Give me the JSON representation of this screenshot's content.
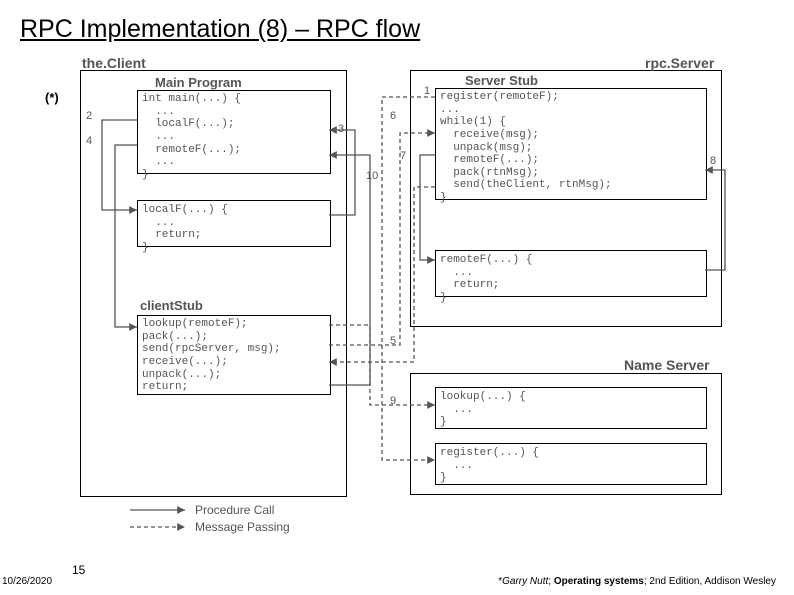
{
  "title": "RPC Implementation (8) – RPC flow",
  "star": "(*)",
  "labels": {
    "client": "the.Client",
    "main": "Main Program",
    "clientStub": "clientStub",
    "rpcServer": "rpc.Server",
    "serverStub": "Server Stub",
    "nameServer": "Name Server"
  },
  "code": {
    "main": "int main(...) {\n  ...\n  localF(...);\n  ...\n  remoteF(...);\n  ...\n}",
    "localF": "localF(...) {\n  ...\n  return;\n}",
    "clientStub": "lookup(remoteF);\npack(...);\nsend(rpcServer, msg);\nreceive(...);\nunpack(...);\nreturn;",
    "serverStub": "register(remoteF);\n...\nwhile(1) {\n  receive(msg);\n  unpack(msg);\n  remoteF(...);\n  pack(rtnMsg);\n  send(theClient, rtnMsg);\n}",
    "remoteF": "remoteF(...) {\n  ...\n  return;\n}",
    "lookup": "lookup(...) {\n  ...\n}",
    "register": "register(...) {\n  ...\n}"
  },
  "numbers": {
    "n1": "1",
    "n2": "2",
    "n3": "3",
    "n4": "4",
    "n5": "5",
    "n6": "6",
    "n7": "7",
    "n8": "8",
    "n9": "9",
    "n10": "10"
  },
  "legend": {
    "proc": "Procedure Call",
    "msg": "Message Passing"
  },
  "footer": {
    "date": "10/26/2020",
    "page": "15",
    "cite_prefix": "*",
    "cite_author": "Garry Nutt",
    "cite_sep": "; ",
    "cite_title": "Operating systems",
    "cite_rest": "; 2nd Edition, Addison Wesley"
  }
}
